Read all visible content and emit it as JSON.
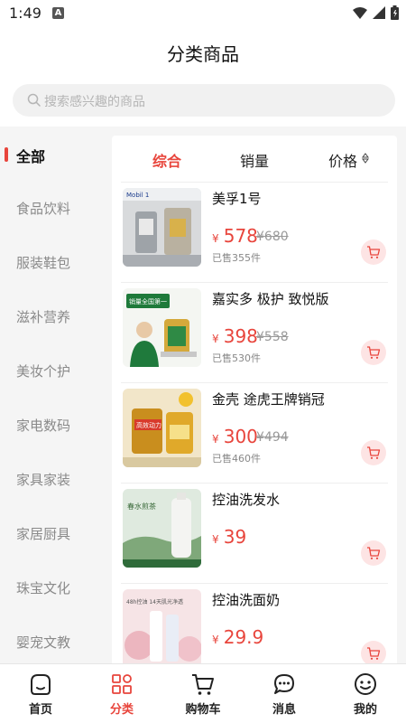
{
  "status": {
    "time": "1:49",
    "notification": "A"
  },
  "header": {
    "title": "分类商品"
  },
  "search": {
    "placeholder": "搜索感兴趣的商品"
  },
  "sidebar": {
    "items": [
      {
        "label": "全部",
        "active": true
      },
      {
        "label": "食品饮料"
      },
      {
        "label": "服装鞋包"
      },
      {
        "label": "滋补营养"
      },
      {
        "label": "美妆个护"
      },
      {
        "label": "家电数码"
      },
      {
        "label": "家具家装"
      },
      {
        "label": "家居厨具"
      },
      {
        "label": "珠宝文化"
      },
      {
        "label": "婴宠文教"
      }
    ]
  },
  "sort": {
    "comprehensive": "综合",
    "sales": "销量",
    "price": "价格"
  },
  "products": [
    {
      "name": "美孚1号",
      "yen": "¥",
      "price": "578",
      "original_price": "¥680",
      "sold": "已售355件",
      "thumb_text": "Mobil 1",
      "image": "mobil-oil-bottles"
    },
    {
      "name": "嘉实多 极护 致悦版",
      "yen": "¥",
      "price": "398",
      "original_price": "¥558",
      "sold": "已售530件",
      "thumb_text": "销量全国第一",
      "image": "castrol-oil-bottle"
    },
    {
      "name": "金壳 途虎王牌销冠",
      "yen": "¥",
      "price": "300",
      "original_price": "¥494",
      "sold": "已售460件",
      "thumb_text": "高效动力",
      "image": "shell-oil-bottle"
    },
    {
      "name": "控油洗发水",
      "yen": "¥",
      "price": "39",
      "original_price": "",
      "sold": "",
      "thumb_text": "春水煎茶",
      "image": "shampoo-bottle"
    },
    {
      "name": "控油洗面奶",
      "yen": "¥",
      "price": "29.9",
      "original_price": "",
      "sold": "",
      "thumb_text": "48h控油 14天肌光净透",
      "image": "cleanser-tubes"
    }
  ],
  "tabbar": {
    "items": [
      {
        "label": "首页",
        "icon": "home-icon"
      },
      {
        "label": "分类",
        "icon": "category-icon",
        "active": true
      },
      {
        "label": "购物车",
        "icon": "cart-icon"
      },
      {
        "label": "消息",
        "icon": "message-icon"
      },
      {
        "label": "我的",
        "icon": "profile-icon"
      }
    ]
  },
  "colors": {
    "accent": "#e8453c",
    "background": "#f5f5f5",
    "cart_button_bg": "#fde4e4"
  }
}
